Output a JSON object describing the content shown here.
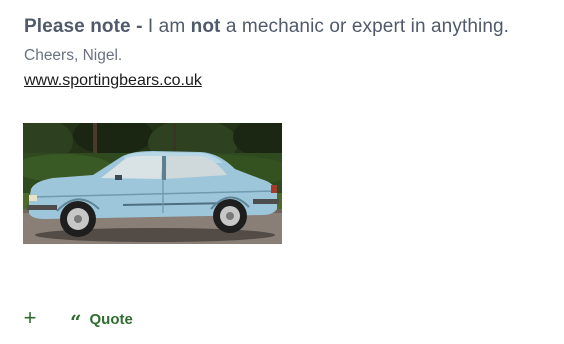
{
  "signature": {
    "note_label": "Please note -",
    "note_text_1": " I am ",
    "note_emphasis": "not",
    "note_text_2": " a mechanic or expert in anything.",
    "cheers": "Cheers, Nigel.",
    "website": "www.sportingbears.co.uk"
  },
  "image": {
    "subject": "light-blue-coupe-car-photo"
  },
  "actions": {
    "add_icon": "plus-icon",
    "quote_icon": "quote-marks-icon",
    "quote_label": "Quote"
  },
  "colors": {
    "action_green": "#2f6e2f",
    "text_slate": "#505a6b",
    "car_blue": "#9ec6da"
  }
}
